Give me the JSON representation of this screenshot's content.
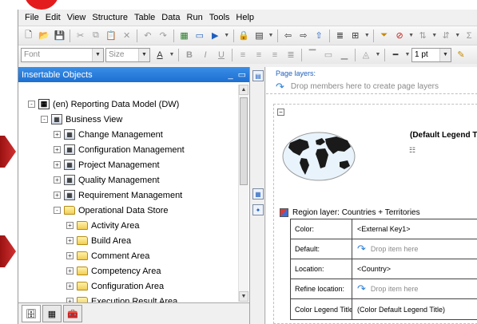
{
  "menu": [
    "File",
    "Edit",
    "View",
    "Structure",
    "Table",
    "Data",
    "Run",
    "Tools",
    "Help"
  ],
  "format_bar": {
    "font_placeholder": "Font",
    "size_placeholder": "Size",
    "line_weight": "1 pt"
  },
  "insertable": {
    "title": "Insertable Objects",
    "tree": [
      {
        "label": "(en) Reporting Data Model (DW)",
        "level": 0,
        "icon": "database-icon",
        "expander": "-"
      },
      {
        "label": "Business View",
        "level": 1,
        "icon": "model-icon",
        "expander": "-"
      },
      {
        "label": "Change Management",
        "level": 2,
        "icon": "model-icon",
        "expander": "+"
      },
      {
        "label": "Configuration Management",
        "level": 2,
        "icon": "model-icon",
        "expander": "+"
      },
      {
        "label": "Project Management",
        "level": 2,
        "icon": "model-icon",
        "expander": "+"
      },
      {
        "label": "Quality Management",
        "level": 2,
        "icon": "model-icon",
        "expander": "+"
      },
      {
        "label": "Requirement Management",
        "level": 2,
        "icon": "model-icon",
        "expander": "+"
      },
      {
        "label": "Operational Data Store",
        "level": 2,
        "icon": "folder-open-icon",
        "expander": "-"
      },
      {
        "label": "Activity Area",
        "level": 3,
        "icon": "folder-icon",
        "expander": "+"
      },
      {
        "label": "Build Area",
        "level": 3,
        "icon": "folder-icon",
        "expander": "+"
      },
      {
        "label": "Comment Area",
        "level": 3,
        "icon": "folder-icon",
        "expander": "+"
      },
      {
        "label": "Competency Area",
        "level": 3,
        "icon": "folder-icon",
        "expander": "+"
      },
      {
        "label": "Configuration Area",
        "level": 3,
        "icon": "folder-icon",
        "expander": "+"
      },
      {
        "label": "Execution Result Area",
        "level": 3,
        "icon": "folder-icon",
        "expander": "+"
      }
    ]
  },
  "page_layers": {
    "title": "Page layers:",
    "hint": "Drop members here to create page layers"
  },
  "map": {
    "legend_title": "(Default Legend T",
    "region_label": "Region layer: Countries + Territories",
    "properties": [
      {
        "label": "Color:",
        "value": "<External Key1>",
        "kind": "value"
      },
      {
        "label": "Default:",
        "value": "Drop item here",
        "kind": "hint"
      },
      {
        "label": "Location:",
        "value": "<Country>",
        "kind": "value"
      },
      {
        "label": "Refine location:",
        "value": "Drop item here",
        "kind": "hint"
      },
      {
        "label": "Color Legend Title:",
        "value": "(Color Default Legend Title)",
        "kind": "value"
      }
    ]
  }
}
